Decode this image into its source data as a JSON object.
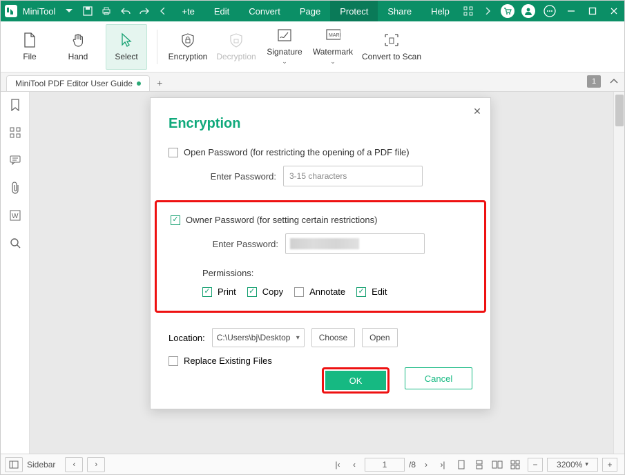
{
  "titlebar": {
    "brand": "MiniTool",
    "menus": {
      "cut": "+te",
      "edit": "Edit",
      "convert": "Convert",
      "page": "Page",
      "protect": "Protect",
      "share": "Share",
      "help": "Help"
    }
  },
  "ribbon": {
    "file": "File",
    "hand": "Hand",
    "select": "Select",
    "encryption": "Encryption",
    "decryption": "Decryption",
    "signature": "Signature",
    "watermark": "Watermark",
    "convertscan": "Convert to Scan"
  },
  "tabs": {
    "doc": "MiniTool PDF Editor User Guide",
    "count": "1"
  },
  "dialog": {
    "title": "Encryption",
    "open_pwd_label": "Open Password (for restricting the opening of a PDF file)",
    "enter_pwd": "Enter Password:",
    "open_pwd_placeholder": "3-15 characters",
    "owner_pwd_label": "Owner Password (for setting certain restrictions)",
    "permissions": "Permissions:",
    "perm_print": "Print",
    "perm_copy": "Copy",
    "perm_annotate": "Annotate",
    "perm_edit": "Edit",
    "location": "Location:",
    "location_value": "C:\\Users\\bj\\Desktop",
    "choose": "Choose",
    "open": "Open",
    "replace": "Replace Existing Files",
    "ok": "OK",
    "cancel": "Cancel"
  },
  "statusbar": {
    "sidebar": "Sidebar",
    "page_current": "1",
    "page_total": "/8",
    "zoom": "3200%"
  }
}
